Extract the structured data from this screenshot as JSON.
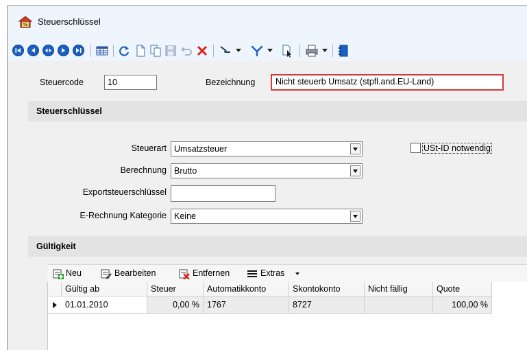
{
  "window": {
    "title": "Steuerschlüssel"
  },
  "header": {
    "steuercode_label": "Steuercode",
    "steuercode_value": "10",
    "bezeichnung_label": "Bezeichnung",
    "bezeichnung_value": "Nicht steuerb Umsatz (stpfl.and.EU-Land)"
  },
  "sections": {
    "steuerschluessel": "Steuerschlüssel",
    "gueltigkeit": "Gültigkeit"
  },
  "form": {
    "steuerart_label": "Steuerart",
    "steuerart_value": "Umsatzsteuer",
    "berechnung_label": "Berechnung",
    "berechnung_value": "Brutto",
    "export_label": "Exportsteuerschlüssel",
    "export_value": "",
    "erechnung_label": "E-Rechnung Kategorie",
    "erechnung_value": "Keine",
    "ustid_label": "USt-ID notwendig"
  },
  "grid_toolbar": {
    "neu": "Neu",
    "bearbeiten": "Bearbeiten",
    "entfernen": "Entfernen",
    "extras": "Extras"
  },
  "grid": {
    "columns": [
      "Gültig ab",
      "Steuer",
      "Automatikkonto",
      "Skontokonto",
      "Nicht fällig",
      "Quote"
    ],
    "rows": [
      [
        "01.01.2010",
        "0,00 %",
        "1767",
        "8727",
        "",
        "100,00 %"
      ]
    ]
  },
  "colors": {
    "nav_blue": "#1a5fc2",
    "highlight_red": "#d33a3a",
    "toolbar_bg": "#eef5fd",
    "form_bg": "#f0f0f0"
  }
}
